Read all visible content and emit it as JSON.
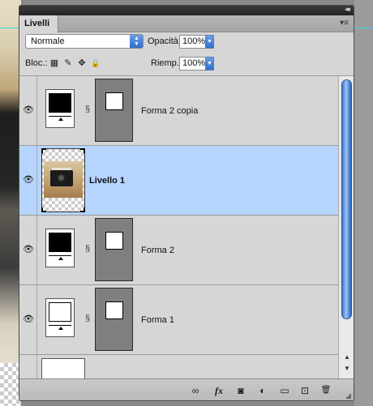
{
  "panel": {
    "title": "Livelli",
    "collapse_glyph": "◂◂",
    "menu_glyph": "▾≡"
  },
  "blend": {
    "mode": "Normale",
    "opacity_label": "Opacità:",
    "opacity_value": "100%",
    "lock_label": "Bloc.:",
    "fill_label": "Riemp.:",
    "fill_value": "100%"
  },
  "icons": {
    "eye": "👁",
    "link": "§",
    "lock_transparency": "▦",
    "lock_paint": "✎",
    "lock_move": "✥",
    "lock_all": "🔒",
    "link_layers": "∞",
    "fx": "fx",
    "add_mask": "◙",
    "adjustment": "◐",
    "folder": "▭",
    "new_layer": "⊡",
    "trash": "🗑",
    "scroll_up": "▲",
    "scroll_down": "▼",
    "grip": "◢",
    "select_arrows": "▲▼",
    "num_arrow": "▼"
  },
  "layers": [
    {
      "name": "Forma 2 copia",
      "kind": "shape",
      "fill": "black",
      "selected": false
    },
    {
      "name": "Livello 1",
      "kind": "raster",
      "selected": true
    },
    {
      "name": "Forma 2",
      "kind": "shape",
      "fill": "black",
      "selected": false
    },
    {
      "name": "Forma 1",
      "kind": "shape",
      "fill": "white",
      "selected": false
    }
  ],
  "colors": {
    "selection": "#b5d5ff",
    "scroll_thumb": "#5f97df",
    "guide": "#30d8e0"
  }
}
